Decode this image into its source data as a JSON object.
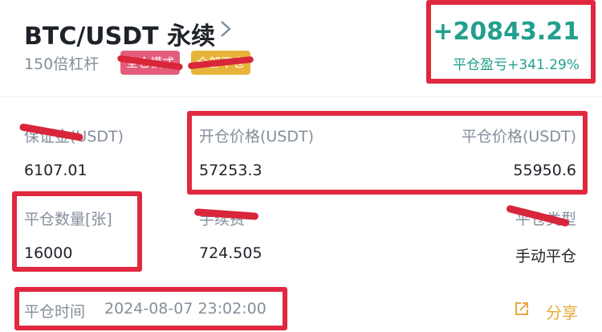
{
  "header": {
    "pair_title": "BTC/USDT 永续",
    "leverage": "150倍杠杆",
    "badge_1": "全仓模式",
    "badge_2": "全部平仓",
    "pnl_value": "+20843.21",
    "pnl_label": "平仓盈亏+341.29%"
  },
  "details": {
    "margin_label": "保证金(USDT)",
    "margin_value": "6107.01",
    "open_price_label": "开仓价格(USDT)",
    "open_price_value": "57253.3",
    "close_price_label": "平仓价格(USDT)",
    "close_price_value": "55950.6",
    "close_qty_label": "平仓数量[张]",
    "close_qty_value": "16000",
    "fee_label": "手续费",
    "fee_value": "724.505",
    "close_type_label": "平仓类型",
    "close_type_value": "手动平仓"
  },
  "footer": {
    "close_time_label": "平仓时间",
    "close_time_value": "2024-08-07 23:02:00",
    "share_label": "分享"
  },
  "colors": {
    "profit": "#22a08d",
    "annotation_red": "#e0283f",
    "share": "#e6a83a",
    "badge_1_bg": "#e35d7a",
    "badge_2_bg": "#e7b43b"
  }
}
